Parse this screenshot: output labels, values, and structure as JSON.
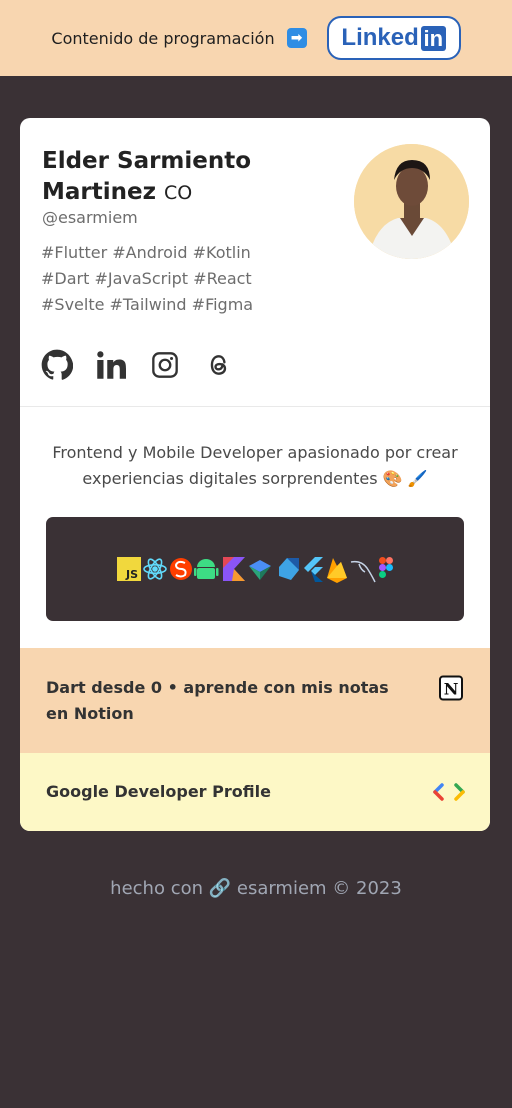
{
  "topbar": {
    "text": "Contenido de programación",
    "linkedin_word": "Linked",
    "linkedin_in": "in"
  },
  "profile": {
    "name": "Elder Sarmiento Martinez",
    "country": "CO",
    "handle": "@esarmiem",
    "tags_line1": "#Flutter #Android #Kotlin",
    "tags_line2": "#Dart #JavaScript #React",
    "tags_line3": "#Svelte #Tailwind #Figma"
  },
  "socials": [
    "github-icon",
    "linkedin-icon",
    "instagram-icon",
    "threads-icon"
  ],
  "bio": "Frontend y Mobile Developer apasionado por crear experiencias digitales sorprendentes 🎨 🖌️",
  "tech": {
    "icons": [
      "javascript-icon",
      "react-icon",
      "svelte-icon",
      "android-icon",
      "kotlin-icon",
      "jetpack-compose-icon",
      "dart-icon",
      "flutter-icon",
      "firebase-icon",
      "mysql-icon",
      "figma-icon"
    ],
    "js_label": "JS"
  },
  "links": {
    "notion": "Dart desde 0 • aprende con mis notas en Notion",
    "notion_icon_letter": "N",
    "gdp": "Google Developer Profile"
  },
  "footer": "hecho con 🔗 esarmiem © 2023",
  "colors": {
    "topbar": "#f8d6b0",
    "background": "#3a3135",
    "linkedin": "#2a62b8",
    "gdp_row": "#fdf8c6"
  }
}
